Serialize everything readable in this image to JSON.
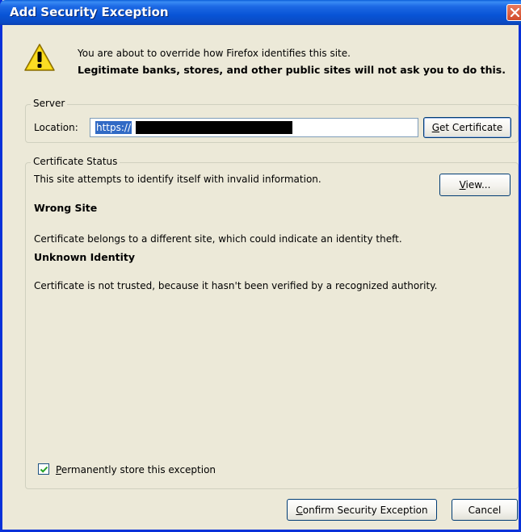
{
  "window": {
    "title": "Add Security Exception"
  },
  "intro": {
    "line1": "You are about to override how Firefox identifies this site.",
    "line2": "Legitimate banks, stores, and other public sites will not ask you to do this."
  },
  "server": {
    "legend": "Server",
    "location_label": "Location:",
    "location_value": "https://",
    "get_certificate_prefix": "G",
    "get_certificate_rest": "et Certificate"
  },
  "status": {
    "legend": "Certificate Status",
    "summary": "This site attempts to identify itself with invalid information.",
    "view_prefix": "V",
    "view_rest": "iew...",
    "wrong_site_heading": "Wrong Site",
    "wrong_site_text": "Certificate belongs to a different site, which could indicate an identity theft.",
    "unknown_identity_heading": "Unknown Identity",
    "unknown_identity_text": "Certificate is not trusted, because it hasn't been verified by a recognized authority."
  },
  "options": {
    "permanent_checked": true,
    "permanent_prefix": "P",
    "permanent_rest": "ermanently store this exception"
  },
  "buttons": {
    "confirm_prefix": "C",
    "confirm_rest": "onfirm Security Exception",
    "cancel": "Cancel"
  },
  "icons": {
    "close": "close-icon",
    "warning": "warning-icon",
    "check": "checkmark-icon"
  },
  "colors": {
    "titlebar": "#0a4bc4",
    "dialog_bg": "#ece9d8",
    "selection": "#316ac5",
    "close_button": "#d14c2d",
    "warning_fill": "#f5d200"
  }
}
